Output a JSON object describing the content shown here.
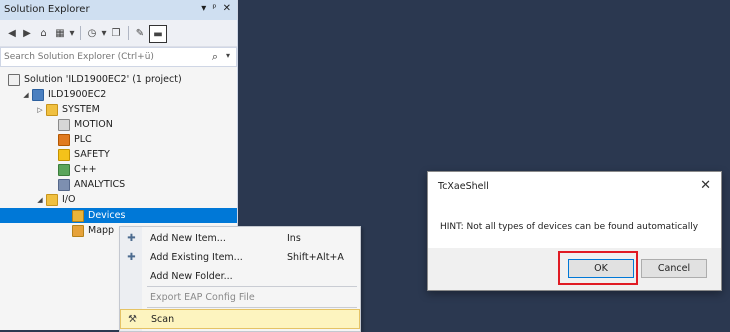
{
  "solution_explorer": {
    "title": "Solution Explorer",
    "title_buttons": [
      "▾",
      "ᵖ",
      "✕"
    ],
    "search_placeholder": "Search Solution Explorer (Ctrl+ü)",
    "tree": [
      {
        "label": "Solution 'ILD1900EC2' (1 project)"
      },
      {
        "label": "ILD1900EC2"
      },
      {
        "label": "SYSTEM"
      },
      {
        "label": "MOTION"
      },
      {
        "label": "PLC"
      },
      {
        "label": "SAFETY"
      },
      {
        "label": "C++"
      },
      {
        "label": "ANALYTICS"
      },
      {
        "label": "I/O"
      },
      {
        "label": "Devices"
      },
      {
        "label": "Mapp"
      }
    ]
  },
  "context_menu": {
    "items": [
      {
        "label": "Add New Item...",
        "shortcut": "Ins"
      },
      {
        "label": "Add Existing Item...",
        "shortcut": "Shift+Alt+A"
      },
      {
        "label": "Add New Folder...",
        "shortcut": ""
      },
      {
        "label": "Export EAP Config File",
        "shortcut": ""
      },
      {
        "label": "Scan",
        "shortcut": ""
      }
    ]
  },
  "dialog": {
    "title": "TcXaeShell",
    "close_glyph": "✕",
    "message": "HINT: Not all types of devices can be found automatically",
    "ok_label": "OK",
    "cancel_label": "Cancel"
  },
  "colors": {
    "background": "#2b3850",
    "selection": "#0078d7",
    "highlight_border": "#e01b24",
    "hover": "#fdf4bf"
  }
}
